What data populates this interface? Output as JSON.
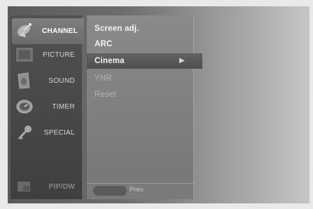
{
  "side_menu": [
    {
      "label": "CHANNEL",
      "icon": "satellite-dish-icon",
      "state": "selected"
    },
    {
      "label": "PICTURE",
      "icon": "picture-icon",
      "state": "normal"
    },
    {
      "label": "SOUND",
      "icon": "speaker-icon",
      "state": "normal"
    },
    {
      "label": "TIMER",
      "icon": "clock-icon",
      "state": "normal"
    },
    {
      "label": "SPECIAL",
      "icon": "key-icon",
      "state": "normal"
    },
    {
      "label": "PIP/DW",
      "icon": "pip-icon",
      "state": "dim"
    }
  ],
  "submenu": [
    {
      "label": "Screen adj.",
      "state": "normal"
    },
    {
      "label": "ARC",
      "state": "normal"
    },
    {
      "label": "Cinema",
      "state": "highlight"
    },
    {
      "label": "YNR",
      "state": "disabled"
    },
    {
      "label": "Reset",
      "state": "disabled"
    }
  ],
  "footer": {
    "prev_label": "Prev."
  },
  "colors": {
    "selected_item": "#7a7a7a",
    "highlight_item": "#555555",
    "panel": "#838383"
  }
}
